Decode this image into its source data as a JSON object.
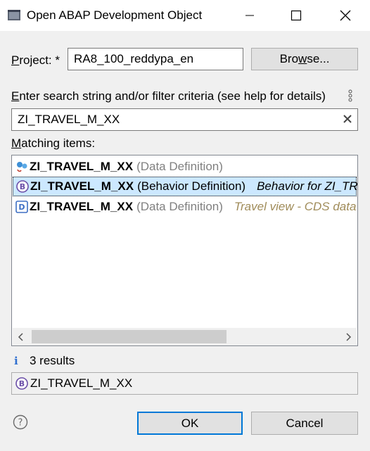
{
  "window": {
    "title": "Open ABAP Development Object",
    "icons": [
      "app-icon",
      "minimize-icon",
      "maximize-icon",
      "close-icon"
    ]
  },
  "project": {
    "label_first": "P",
    "label_rest": "roject: *",
    "value": "RA8_100_reddypa_en",
    "browse_pre": "Bro",
    "browse_u": "w",
    "browse_post": "se..."
  },
  "search": {
    "label_first": "E",
    "label_rest": "nter search string and/or filter criteria (see help for details)",
    "value": "ZI_TRAVEL_M_XX",
    "clear_icon": "clear-icon",
    "options_icon": "filter-options-icon"
  },
  "matching": {
    "label_first": "M",
    "label_rest": "atching items:",
    "items": [
      {
        "name": "ZI_TRAVEL_M_XX",
        "type": "(Data Definition)",
        "description": "",
        "icon": "data-definition-link-icon"
      },
      {
        "name": "ZI_TRAVEL_M_XX",
        "type": "(Behavior Definition)",
        "description": "Behavior for ZI_TRAVEL_M_XX",
        "icon": "behavior-definition-icon"
      },
      {
        "name": "ZI_TRAVEL_M_XX",
        "type": "(Data Definition)",
        "description": "Travel view - CDS data model",
        "icon": "data-definition-icon"
      }
    ]
  },
  "status": {
    "results": "3 results",
    "selected": "ZI_TRAVEL_M_XX"
  },
  "buttons": {
    "ok": "OK",
    "cancel": "Cancel"
  },
  "colors": {
    "selection": "#cce8ff",
    "default_button_border": "#0078d7",
    "behavior_icon": "#6b4fa8",
    "data_def_icon": "#3e6fc4",
    "description_gold": "#a08c5a"
  }
}
